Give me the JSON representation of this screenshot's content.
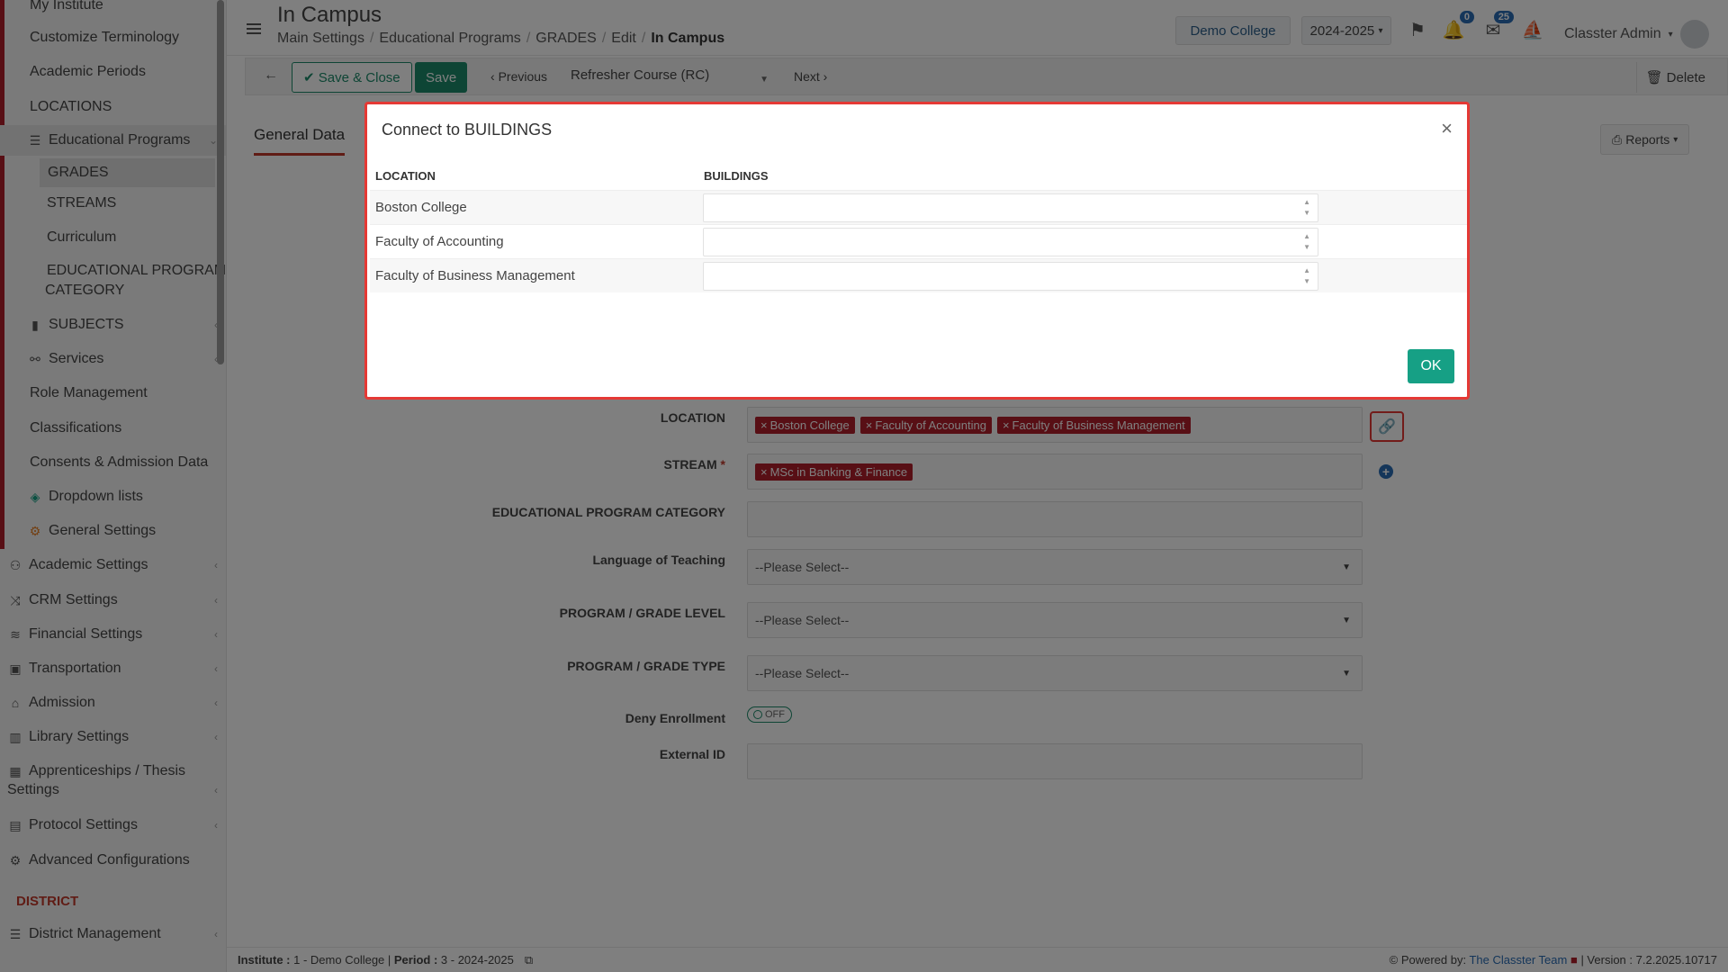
{
  "sidebar": {
    "items": [
      {
        "label": "My Institute"
      },
      {
        "label": "Customize Terminology"
      },
      {
        "label": "Academic Periods"
      },
      {
        "label": "LOCATIONS"
      },
      {
        "label": "Educational Programs"
      },
      {
        "label": "GRADES"
      },
      {
        "label": "STREAMS"
      },
      {
        "label": "Curriculum"
      },
      {
        "label": "EDUCATIONAL PROGRAM"
      },
      {
        "label": "CATEGORY"
      },
      {
        "label": "SUBJECTS"
      },
      {
        "label": "Services"
      },
      {
        "label": "Role Management"
      },
      {
        "label": "Classifications"
      },
      {
        "label": "Consents & Admission Data"
      },
      {
        "label": "Dropdown lists"
      },
      {
        "label": "General Settings"
      },
      {
        "label": "Academic Settings"
      },
      {
        "label": "CRM Settings"
      },
      {
        "label": "Financial Settings"
      },
      {
        "label": "Transportation"
      },
      {
        "label": "Admission"
      },
      {
        "label": "Library Settings"
      },
      {
        "label": "Apprenticeships / Thesis"
      },
      {
        "label": "Settings"
      },
      {
        "label": "Protocol Settings"
      },
      {
        "label": "Advanced Configurations"
      },
      {
        "label": "District Management"
      }
    ],
    "district_label": "DISTRICT"
  },
  "header": {
    "title": "In Campus",
    "breadcrumb": [
      "Main Settings",
      "Educational Programs",
      "GRADES",
      "Edit",
      "In Campus"
    ],
    "college": "Demo College",
    "period": "2024-2025",
    "notif_count": "0",
    "msg_count": "25",
    "user": "Classter Admin"
  },
  "toolbar": {
    "save_close": "Save & Close",
    "save": "Save",
    "previous": "Previous",
    "selected_course": "Refresher Course (RC)",
    "next": "Next",
    "delete": "Delete"
  },
  "tabs": {
    "general": "General Data",
    "reports": "Reports"
  },
  "form": {
    "location_label": "LOCATION",
    "location_tags": [
      "Boston College",
      "Faculty of Accounting",
      "Faculty of Business Management"
    ],
    "stream_label": "STREAM",
    "stream_req": "*",
    "stream_tags": [
      "MSc in Banking & Finance"
    ],
    "category_label": "EDUCATIONAL PROGRAM CATEGORY",
    "language_label": "Language of Teaching",
    "language_value": "--Please Select--",
    "level_label": "PROGRAM / GRADE LEVEL",
    "level_value": "--Please Select--",
    "type_label": "PROGRAM / GRADE TYPE",
    "type_value": "--Please Select--",
    "deny_label": "Deny Enrollment",
    "deny_value": "OFF",
    "external_label": "External ID"
  },
  "modal": {
    "title": "Connect to BUILDINGS",
    "col_location": "LOCATION",
    "col_buildings": "BUILDINGS",
    "rows": [
      {
        "location": "Boston College",
        "buildings": ""
      },
      {
        "location": "Faculty of Accounting",
        "buildings": ""
      },
      {
        "location": "Faculty of Business Management",
        "buildings": ""
      }
    ],
    "ok": "OK"
  },
  "footer": {
    "institute_key": "Institute :",
    "institute_value": "1 - Demo College",
    "period_key": "Period :",
    "period_value": "3 - 2024-2025",
    "powered_by": "Powered by:",
    "team": "The Classter Team",
    "version": "| Version : 7.2.2025.10717"
  }
}
